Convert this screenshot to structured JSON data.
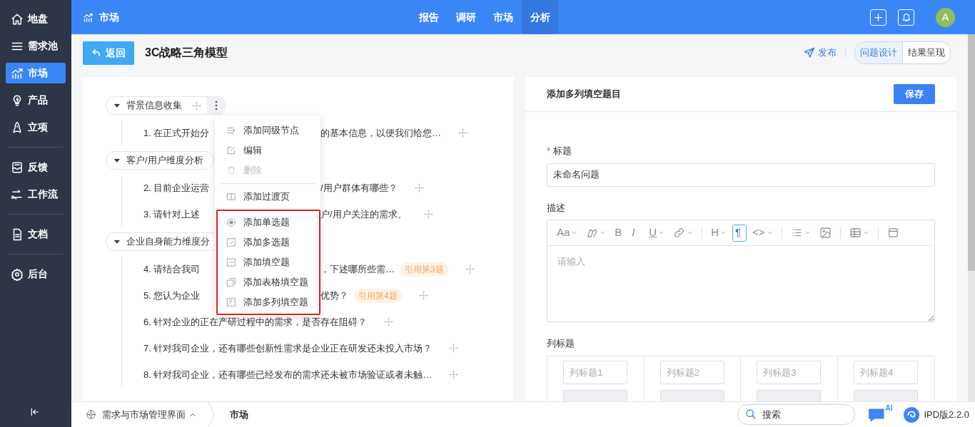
{
  "sidebar": {
    "groups": [
      [
        {
          "label": "地盘",
          "selected": false
        },
        {
          "label": "需求池",
          "selected": false
        },
        {
          "label": "市场",
          "selected": true
        },
        {
          "label": "产品",
          "selected": false
        },
        {
          "label": "立项",
          "selected": false
        }
      ],
      [
        {
          "label": "反馈",
          "selected": false
        },
        {
          "label": "工作流",
          "selected": false
        }
      ],
      [
        {
          "label": "文档",
          "selected": false
        }
      ],
      [
        {
          "label": "后台",
          "selected": false
        }
      ]
    ]
  },
  "topbar": {
    "title": "市场",
    "tabs": [
      {
        "label": "报告",
        "selected": false
      },
      {
        "label": "调研",
        "selected": false
      },
      {
        "label": "市场",
        "selected": false
      },
      {
        "label": "分析",
        "selected": true
      }
    ],
    "avatar": "A"
  },
  "header": {
    "back_button": "返回",
    "title": "3C战略三角模型",
    "publish": "发布",
    "views": [
      {
        "label": "问题设计",
        "selected": true
      },
      {
        "label": "结果呈现",
        "selected": false
      }
    ]
  },
  "tree": {
    "groups": [
      {
        "label": "背景信息收集",
        "expanded": true,
        "move_handle": true,
        "more_button": true,
        "items": [
          {
            "head": "1. 在正式开始分",
            "tail": "的基本信息，以便我们给您…"
          }
        ]
      },
      {
        "label": "客户/用户维度分析",
        "expanded": true,
        "move_handle": false,
        "items": [
          {
            "head": "2. 目前企业运营",
            "tail": "/用户群体有哪些？"
          },
          {
            "head": "3. 请针对上述",
            "tail": "户/用户关注的需求。"
          }
        ]
      },
      {
        "label": "企业自身能力维度分",
        "expanded": true,
        "move_handle": false,
        "items": [
          {
            "head": "4. 请结合我司",
            "tail": "，下述哪所些需…",
            "reference": "引用第3题"
          },
          {
            "head": "5. 您认为企业",
            "tail": "优势？",
            "reference": "引用第4题"
          },
          {
            "text": "6. 针对企业的正在产研过程中的需求，是否存在阻碍？"
          },
          {
            "text": "7. 针对我司企业，还有哪些创新性需求是企业正在研发还未投入市场？"
          },
          {
            "text": "8. 针对我司企业，还有哪些已经发布的需求还未被市场验证或者未触…"
          }
        ]
      }
    ],
    "context_menu": {
      "sections": [
        {
          "items": [
            {
              "label": "添加同级节点",
              "disabled": false
            },
            {
              "label": "编辑",
              "disabled": false
            },
            {
              "label": "删除",
              "disabled": true
            }
          ]
        },
        {
          "items": [
            {
              "label": "添加过渡页",
              "disabled": false
            }
          ]
        },
        {
          "highlighted": true,
          "items": [
            {
              "label": "添加单选题",
              "disabled": false
            },
            {
              "label": "添加多选题",
              "disabled": false
            },
            {
              "label": "添加填空题",
              "disabled": false
            },
            {
              "label": "添加表格填空题",
              "disabled": false
            },
            {
              "label": "添加多列填空题",
              "disabled": false
            }
          ]
        }
      ]
    }
  },
  "editor": {
    "title": "添加多列填空题目",
    "save": "保存",
    "required_mark": "*",
    "title_label": "标题",
    "title_value": "未命名问题",
    "description_label": "描述",
    "description_placeholder": "请输入",
    "toolbar": [
      {
        "kind": "glyph",
        "label": "Aa",
        "caret": true,
        "selected": false
      },
      {
        "kind": "brush",
        "caret": true,
        "selected": false
      },
      {
        "kind": "glyph",
        "label": "B",
        "selected": false
      },
      {
        "kind": "italic",
        "label": "I",
        "selected": false
      },
      {
        "kind": "underline",
        "label": "U",
        "caret": true,
        "selected": false
      },
      {
        "kind": "link",
        "caret": true,
        "selected": false
      },
      {
        "kind": "separator"
      },
      {
        "kind": "glyph",
        "label": "H",
        "caret": true,
        "selected": false
      },
      {
        "kind": "glyph",
        "label": "¶",
        "selected": true
      },
      {
        "kind": "glyph",
        "label": "<>",
        "caret": true,
        "selected": false
      },
      {
        "kind": "separator"
      },
      {
        "kind": "list",
        "caret": true,
        "selected": false
      },
      {
        "kind": "image",
        "selected": false
      },
      {
        "kind": "separator"
      },
      {
        "kind": "table",
        "caret": true,
        "selected": false
      },
      {
        "kind": "separator"
      },
      {
        "kind": "layout",
        "selected": false
      }
    ],
    "columns_label": "列标题",
    "columns": [
      {
        "placeholder": "列标题1"
      },
      {
        "placeholder": "列标题2"
      },
      {
        "placeholder": "列标题3"
      },
      {
        "placeholder": "列标题4"
      }
    ]
  },
  "footer": {
    "app": "需求与市场管理界面",
    "breadcrumb": "市场",
    "search_placeholder": "搜索",
    "ai_badge": "AI",
    "version": "IPD版2.2.0"
  }
}
